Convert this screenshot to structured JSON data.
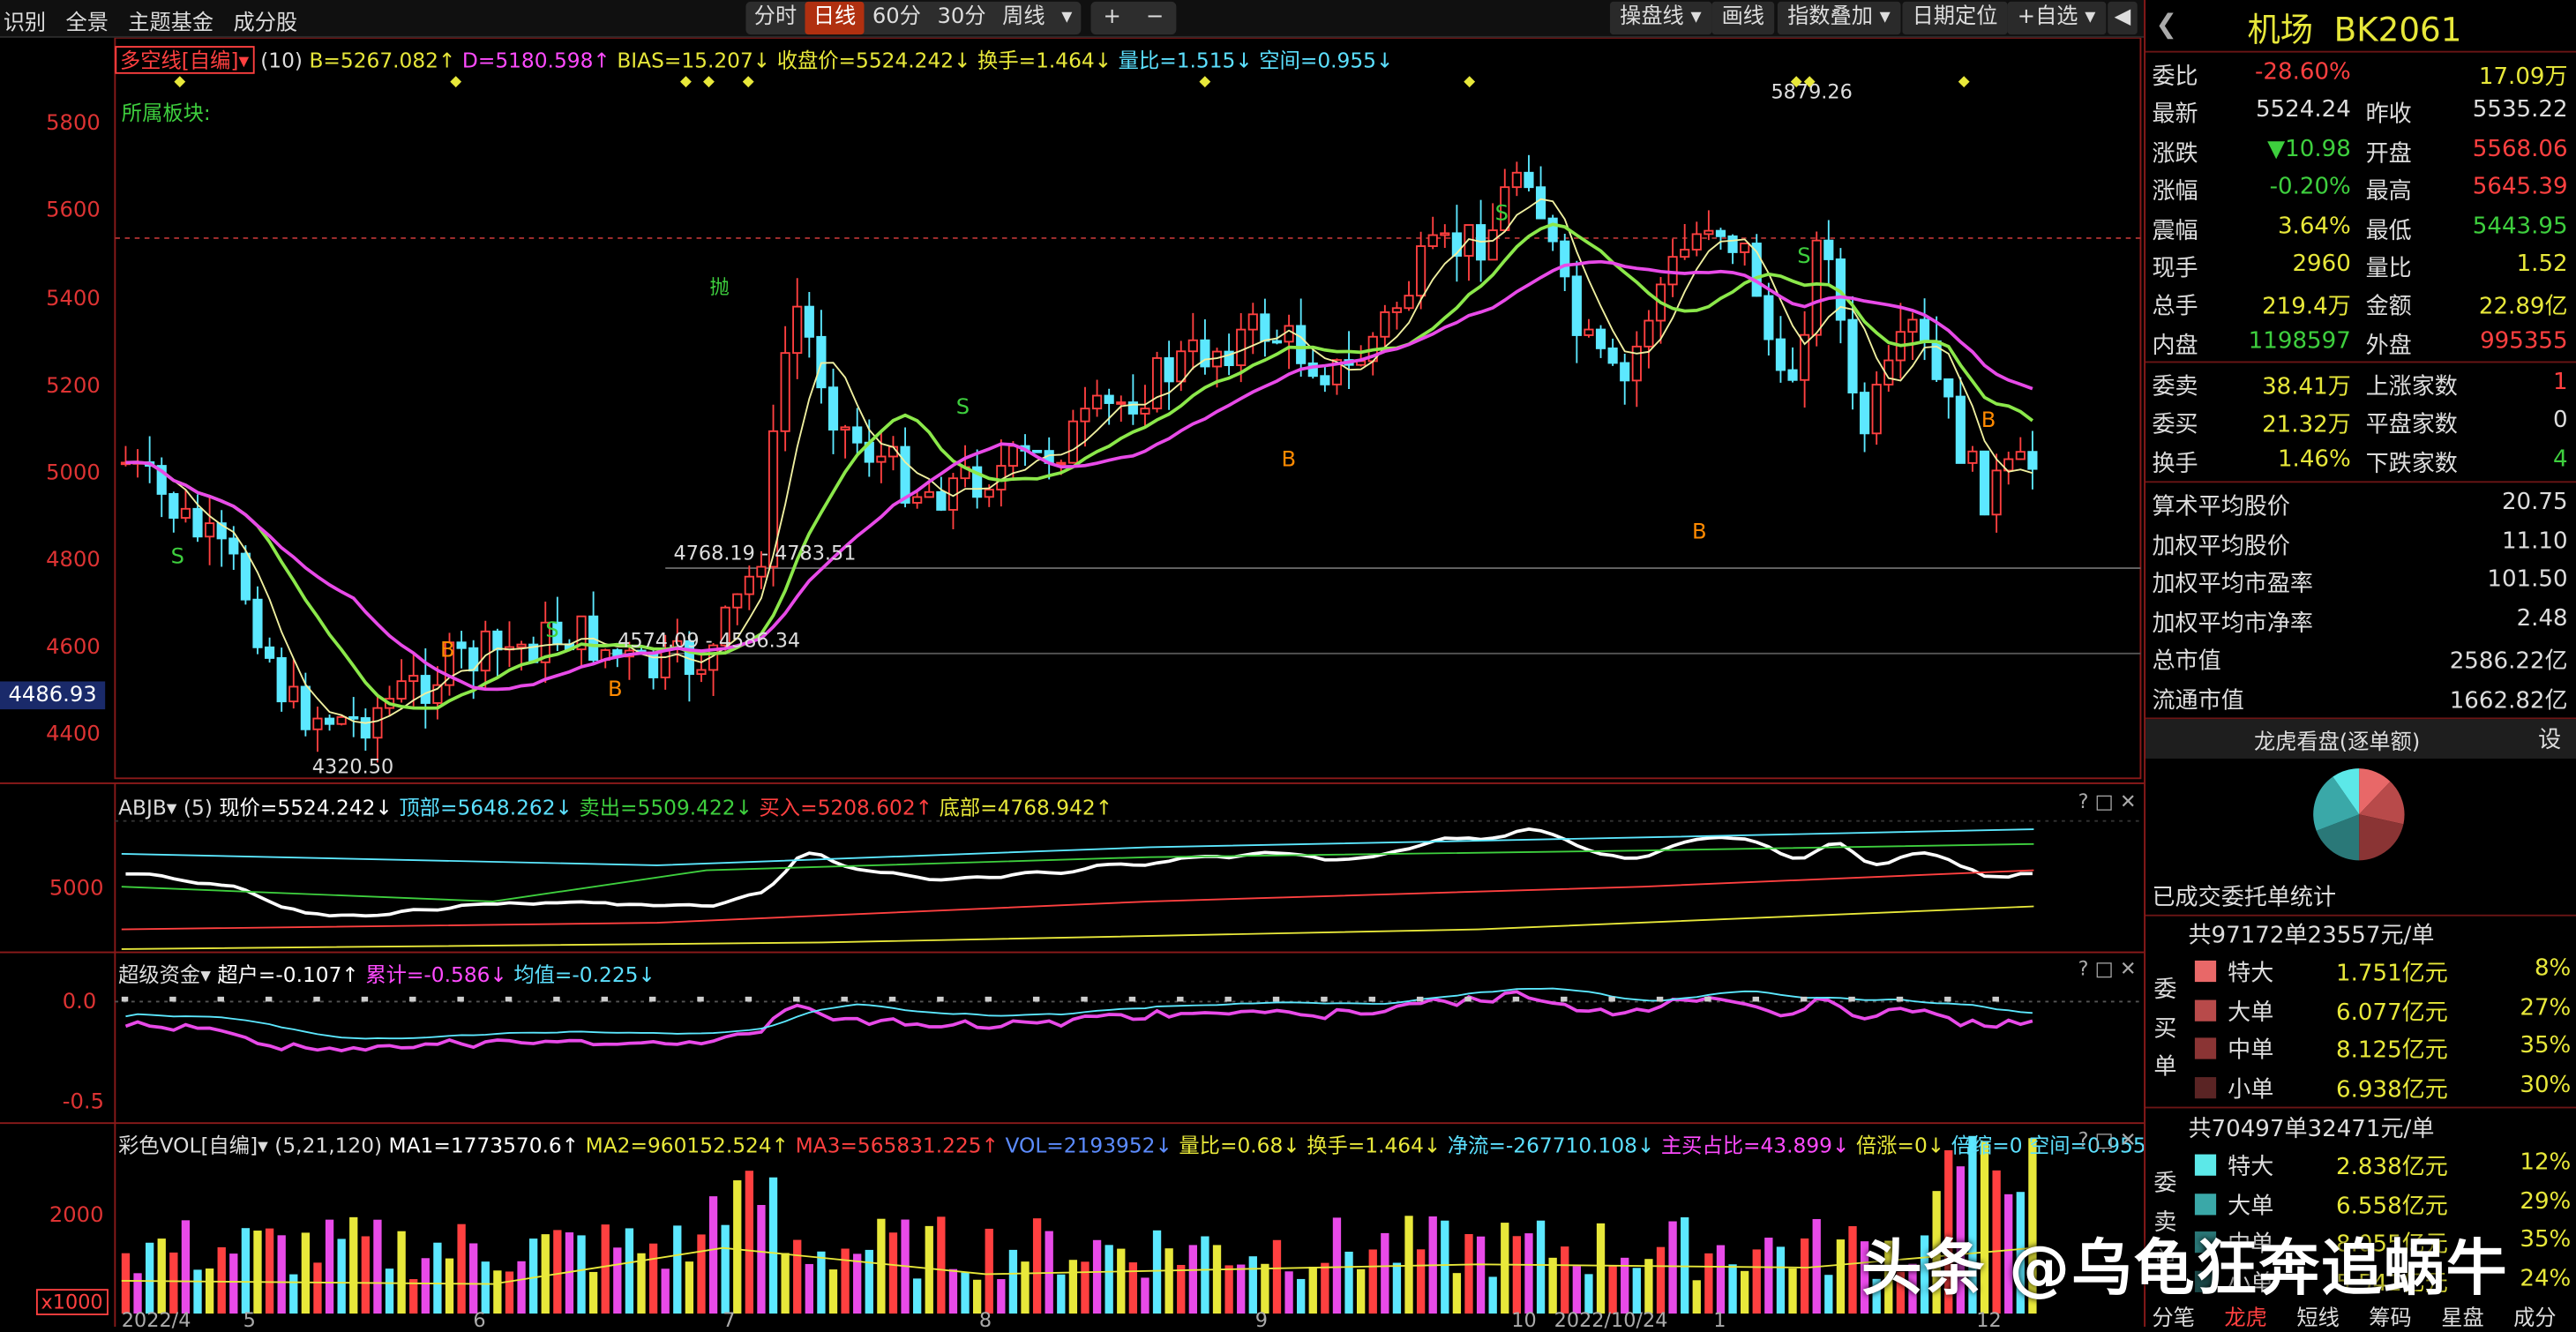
{
  "toolbar": {
    "left_items": [
      "识别",
      "全景",
      "主题基金",
      "成分股"
    ],
    "periods": [
      "分时",
      "日线",
      "60分",
      "30分",
      "周线"
    ],
    "active_period": "日线",
    "period_dropdown": "▾",
    "zoom_in": "+",
    "zoom_out": "−",
    "right_items": [
      "操盘线",
      "画线",
      "指数叠加",
      "日期定位",
      "+自选"
    ],
    "back_arrow": "◀",
    "colors": {
      "accent": "#b03010",
      "bg": "#101010"
    }
  },
  "main_chart": {
    "indicator_name": "多空线[自编]",
    "param": "(10)",
    "readouts": [
      {
        "text": "B=5267.082↑",
        "color": "#e8e83a"
      },
      {
        "text": "D=5180.598↑",
        "color": "#ff4bff"
      },
      {
        "text": "BIAS=15.207↓",
        "color": "#e8e83a"
      },
      {
        "text": "收盘价=5524.242↓",
        "color": "#e8e83a"
      },
      {
        "text": "换手=1.464↓",
        "color": "#e8e83a"
      },
      {
        "text": "量比=1.515↓",
        "color": "#5ce0ff"
      },
      {
        "text": "空间=0.955↓",
        "color": "#5ce0ff"
      }
    ],
    "sector_label": "所属板块:",
    "y_ticks": [
      "5800",
      "5600",
      "5400",
      "5200",
      "5000",
      "4800",
      "4600",
      "4400"
    ],
    "current_price_tag": "4486.93",
    "annotations": {
      "high": "5879.26",
      "low": "4320.50",
      "range1": "4768.19 - 4783.51",
      "range2": "4574.09 - 4586.34",
      "exit": "抛"
    },
    "signal_labels": {
      "buy": "B",
      "sell": "S"
    }
  },
  "abjb_panel": {
    "name": "ABJB",
    "param": "(5)",
    "readouts": [
      {
        "text": "现价=5524.242↓",
        "color": "#ffffff"
      },
      {
        "text": "顶部=5648.262↓",
        "color": "#5ce0ff"
      },
      {
        "text": "卖出=5509.422↓",
        "color": "#3ecf3e"
      },
      {
        "text": "买入=5208.602↑",
        "color": "#ff4040"
      },
      {
        "text": "底部=4768.942↑",
        "color": "#e8e83a"
      }
    ],
    "y_tick": "5000",
    "icons": [
      "?",
      "□",
      "✕"
    ]
  },
  "fund_panel": {
    "name": "超级资金",
    "readouts": [
      {
        "text": "超户=-0.107↑",
        "color": "#ffffff"
      },
      {
        "text": "累计=-0.586↓",
        "color": "#ff4bff"
      },
      {
        "text": "均值=-0.225↓",
        "color": "#5ce0ff"
      }
    ],
    "y_ticks": [
      "0.0",
      "-0.5"
    ],
    "icons": [
      "?",
      "□",
      "✕"
    ]
  },
  "vol_panel": {
    "name": "彩色VOL[自编]",
    "param": "(5,21,120)",
    "readouts": [
      {
        "text": "MA1=1773570.6↑",
        "color": "#ffffff"
      },
      {
        "text": "MA2=960152.524↑",
        "color": "#e8e83a"
      },
      {
        "text": "MA3=565831.225↑",
        "color": "#ff4040"
      },
      {
        "text": "VOL=2193952↓",
        "color": "#5c8cff"
      },
      {
        "text": "量比=0.68↓",
        "color": "#e8e83a"
      },
      {
        "text": "换手=1.464↓",
        "color": "#e8e83a"
      },
      {
        "text": "净流=-267710.108↓",
        "color": "#5ce0ff"
      },
      {
        "text": "主买占比=43.899↓",
        "color": "#ff4bff"
      },
      {
        "text": "倍涨=0↓",
        "color": "#e8e83a"
      },
      {
        "text": "倍缩=0",
        "color": "#5ce0ff"
      },
      {
        "text": "空间=0.955↓",
        "color": "#5ce0ff"
      }
    ],
    "y_tick": "2000",
    "unit": "x1000",
    "icons": [
      "?",
      "□",
      "✕"
    ]
  },
  "x_axis": [
    "2022/4",
    "5",
    "6",
    "7",
    "8",
    "9",
    "10",
    "2022/10/24",
    "1",
    "12"
  ],
  "quote": {
    "name": "机场",
    "code": "BK2061",
    "rows": [
      {
        "k": "委比",
        "v": "-28.60%",
        "vc": "red",
        "k2": "",
        "v2": "17.09万",
        "v2c": "yellow"
      },
      {
        "k": "最新",
        "v": "5524.24",
        "vc": "white",
        "k2": "昨收",
        "v2": "5535.22",
        "v2c": "white"
      },
      {
        "k": "涨跌",
        "v": "▼10.98",
        "vc": "green",
        "k2": "开盘",
        "v2": "5568.06",
        "v2c": "red"
      },
      {
        "k": "涨幅",
        "v": "-0.20%",
        "vc": "green",
        "k2": "最高",
        "v2": "5645.39",
        "v2c": "red"
      },
      {
        "k": "震幅",
        "v": "3.64%",
        "vc": "yellow",
        "k2": "最低",
        "v2": "5443.95",
        "v2c": "green"
      },
      {
        "k": "现手",
        "v": "2960",
        "vc": "yellow",
        "k2": "量比",
        "v2": "1.52",
        "v2c": "yellow"
      },
      {
        "k": "总手",
        "v": "219.4万",
        "vc": "yellow",
        "k2": "金额",
        "v2": "22.89亿",
        "v2c": "yellow"
      },
      {
        "k": "内盘",
        "v": "1198597",
        "vc": "green",
        "k2": "外盘",
        "v2": "995355",
        "v2c": "red"
      }
    ],
    "rows2": [
      {
        "k": "委卖",
        "v": "38.41万",
        "vc": "yellow",
        "k2": "上涨家数",
        "v2": "1",
        "v2c": "red"
      },
      {
        "k": "委买",
        "v": "21.32万",
        "vc": "yellow",
        "k2": "平盘家数",
        "v2": "0",
        "v2c": "white"
      },
      {
        "k": "换手",
        "v": "1.46%",
        "vc": "yellow",
        "k2": "下跌家数",
        "v2": "4",
        "v2c": "green"
      }
    ],
    "rows3": [
      {
        "k": "算术平均股价",
        "v": "20.75"
      },
      {
        "k": "加权平均股价",
        "v": "11.10"
      },
      {
        "k": "加权平均市盈率",
        "v": "101.50"
      },
      {
        "k": "加权平均市净率",
        "v": "2.48"
      },
      {
        "k": "总市值",
        "v": "2586.22亿"
      },
      {
        "k": "流通市值",
        "v": "1662.82亿"
      }
    ],
    "dragon_title": "龙虎看盘(逐单额)",
    "settings": "设",
    "stats_title": "已成交委托单统计",
    "sell_summary": "共97172单23557元/单",
    "buy_summary": "共70497单32471元/单",
    "sell_side": [
      "委",
      "买",
      "单"
    ],
    "buy_side": [
      "委",
      "卖",
      "单"
    ],
    "sell_rows": [
      {
        "label": "特大",
        "amount": "1.751亿元",
        "pct": "8%",
        "color": "#e86868"
      },
      {
        "label": "大单",
        "amount": "6.077亿元",
        "pct": "27%",
        "color": "#b84a4a"
      },
      {
        "label": "中单",
        "amount": "8.125亿元",
        "pct": "35%",
        "color": "#8a3434"
      },
      {
        "label": "小单",
        "amount": "6.938亿元",
        "pct": "30%",
        "color": "#5a2424"
      }
    ],
    "buy_rows": [
      {
        "label": "特大",
        "amount": "2.838亿元",
        "pct": "12%",
        "color": "#5ce8e8"
      },
      {
        "label": "大单",
        "amount": "6.558亿元",
        "pct": "29%",
        "color": "#3aa8a8"
      },
      {
        "label": "中单",
        "amount": "8.055亿元",
        "pct": "35%",
        "color": "#2a7878"
      },
      {
        "label": "小单",
        "amount": "5.541亿元",
        "pct": "24%",
        "color": "#1e5050"
      }
    ],
    "bottom_tabs": [
      "分笔",
      "龙虎",
      "短线",
      "筹码",
      "星盘",
      "成分"
    ],
    "active_bottom_tab": "龙虎"
  },
  "watermark": "头条 @乌龟狂奔追蜗牛"
}
